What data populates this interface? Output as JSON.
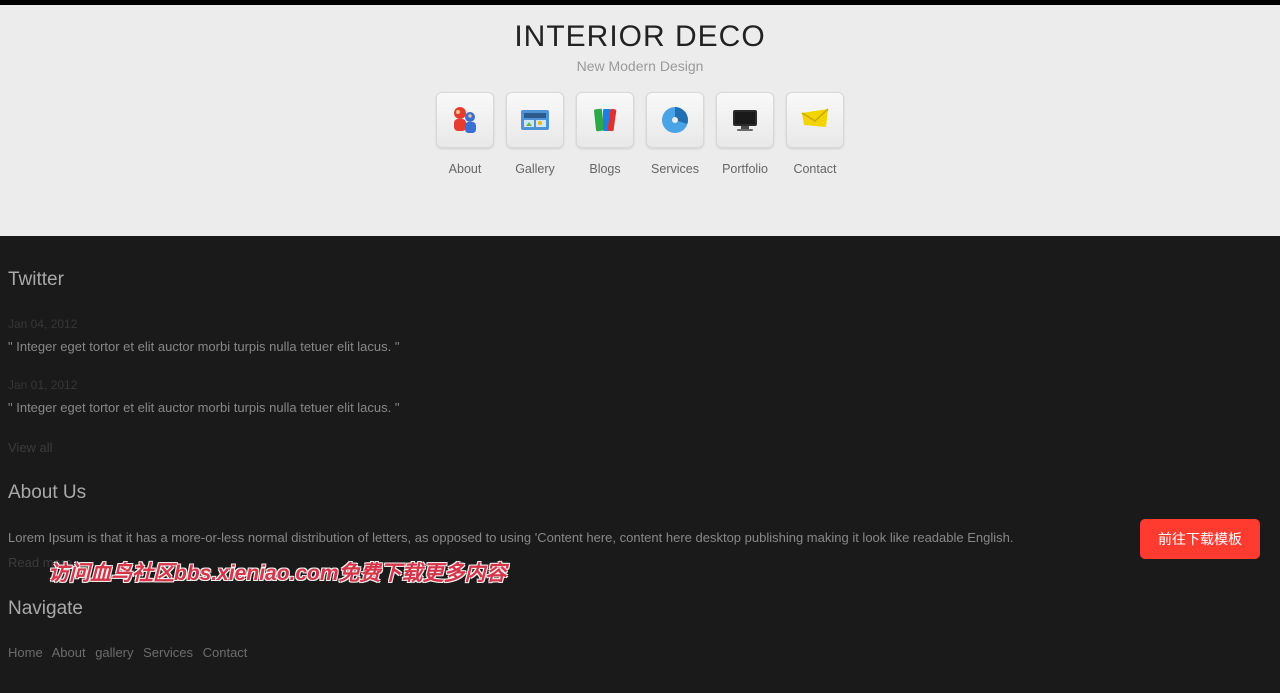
{
  "header": {
    "title": "INTERIOR DECO",
    "subtitle": "New Modern Design"
  },
  "nav": [
    {
      "label": "About",
      "icon": "about-icon"
    },
    {
      "label": "Gallery",
      "icon": "gallery-icon"
    },
    {
      "label": "Blogs",
      "icon": "blogs-icon"
    },
    {
      "label": "Services",
      "icon": "services-icon"
    },
    {
      "label": "Portfolio",
      "icon": "portfolio-icon"
    },
    {
      "label": "Contact",
      "icon": "contact-icon"
    }
  ],
  "twitter": {
    "heading": "Twitter",
    "tweets": [
      {
        "date": "Jan 04, 2012",
        "text": "\" Integer eget tortor et elit auctor morbi turpis nulla tetuer elit lacus. \""
      },
      {
        "date": "Jan 01, 2012",
        "text": "\" Integer eget tortor et elit auctor morbi turpis nulla tetuer elit lacus. \""
      }
    ],
    "view_all": "View all"
  },
  "about": {
    "heading": "About Us",
    "text": "Lorem Ipsum is that it has a more-or-less normal distribution of letters, as opposed to using 'Content here, content here desktop publishing making it look like readable English.",
    "read_more": "Read more"
  },
  "navigate": {
    "heading": "Navigate",
    "links": [
      "Home",
      "About",
      "gallery",
      "Services",
      "Contact"
    ]
  },
  "download_button": "前往下载模板",
  "watermark": "访问血鸟社区bbs.xieniao.com免费下载更多内容"
}
